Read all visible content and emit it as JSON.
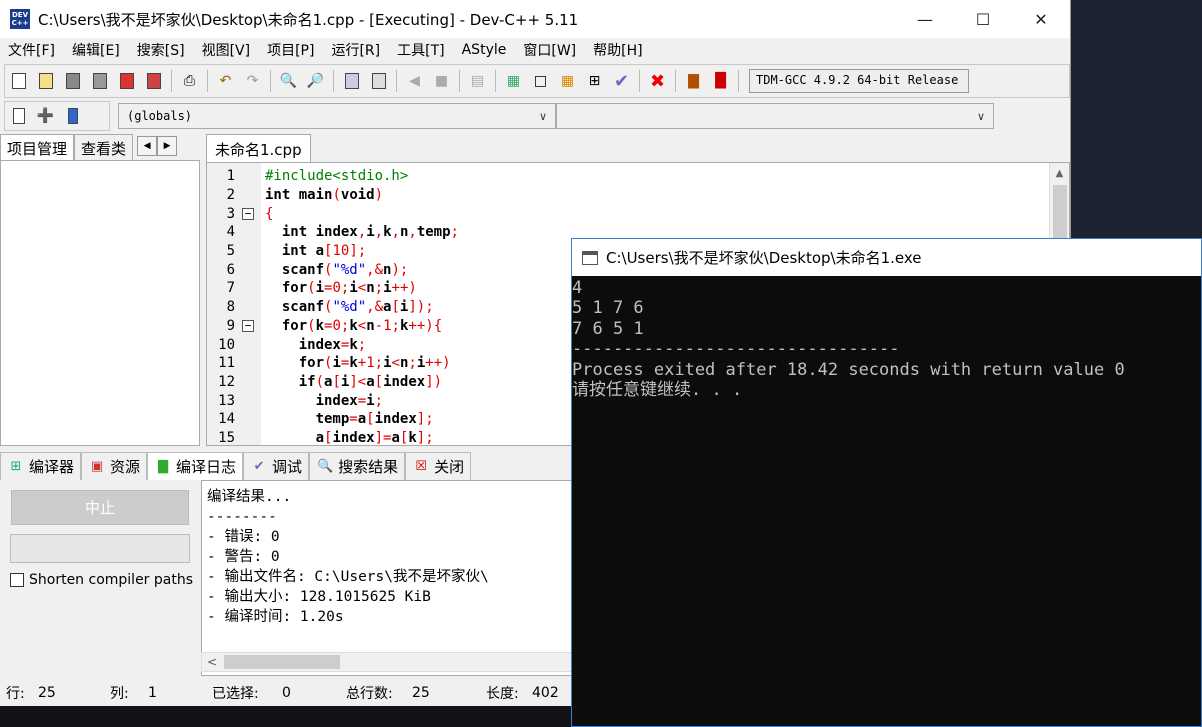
{
  "ide": {
    "title": "C:\\Users\\我不是坏家伙\\Desktop\\未命名1.cpp - [Executing] - Dev-C++ 5.11",
    "app_icon_text": "DEV C++",
    "menu": [
      "文件[F]",
      "编辑[E]",
      "搜索[S]",
      "视图[V]",
      "项目[P]",
      "运行[R]",
      "工具[T]",
      "AStyle",
      "窗口[W]",
      "帮助[H]"
    ],
    "compiler_select": "TDM-GCC 4.9.2 64-bit Release",
    "scope_combo": "(globals)",
    "left_tabs": [
      "项目管理",
      "查看类"
    ],
    "editor_tab": "未命名1.cpp",
    "bottom_tabs": [
      "编译器",
      "资源",
      "编译日志",
      "调试",
      "搜索结果",
      "关闭"
    ],
    "abort_button": "中止",
    "shorten_paths_label": "Shorten compiler paths",
    "log_lines": [
      "编译结果...",
      "--------",
      "- 错误: 0",
      "- 警告: 0",
      "- 输出文件名: C:\\Users\\我不是坏家伙\\",
      "- 输出大小: 128.1015625 KiB",
      "- 编译时间: 1.20s"
    ],
    "status": {
      "row_label": "行:",
      "row_value": "25",
      "col_label": "列:",
      "col_value": "1",
      "sel_label": "已选择:",
      "sel_value": "0",
      "lines_label": "总行数:",
      "lines_value": "25",
      "len_label": "长度:",
      "len_value": "402"
    }
  },
  "code_lines": [
    {
      "n": "1",
      "fold": "",
      "html": "<span class=\"pp\">#include&lt;stdio.h&gt;</span>"
    },
    {
      "n": "2",
      "fold": "",
      "html": "<span class=\"kw\">int</span> <b>main</b><span class=\"sym\">(</span><span class=\"kw\">void</span><span class=\"sym\">)</span>"
    },
    {
      "n": "3",
      "fold": "−",
      "html": "<span class=\"sym\">{</span>"
    },
    {
      "n": "4",
      "fold": "",
      "html": "  <span class=\"kw\">int</span> <b>index</b><span class=\"sym\">,</span><b>i</b><span class=\"sym\">,</span><b>k</b><span class=\"sym\">,</span><b>n</b><span class=\"sym\">,</span><b>temp</b><span class=\"sym\">;</span>"
    },
    {
      "n": "5",
      "fold": "",
      "html": "  <span class=\"kw\">int</span> <b>a</b><span class=\"sym\">[</span><span class=\"num\">10</span><span class=\"sym\">];</span>"
    },
    {
      "n": "6",
      "fold": "",
      "html": "  <b>scanf</b><span class=\"sym\">(</span><span class=\"str\">\"%d\"</span><span class=\"sym\">,&amp;</span><b>n</b><span class=\"sym\">);</span>"
    },
    {
      "n": "7",
      "fold": "",
      "html": "  <span class=\"kw\">for</span><span class=\"sym\">(</span><b>i</b><span class=\"sym\">=</span><span class=\"num\">0</span><span class=\"sym\">;</span><b>i</b><span class=\"sym\">&lt;</span><b>n</b><span class=\"sym\">;</span><b>i</b><span class=\"sym\">++)</span>"
    },
    {
      "n": "8",
      "fold": "",
      "html": "  <b>scanf</b><span class=\"sym\">(</span><span class=\"str\">\"%d\"</span><span class=\"sym\">,&amp;</span><b>a</b><span class=\"sym\">[</span><b>i</b><span class=\"sym\">]);</span>"
    },
    {
      "n": "9",
      "fold": "−",
      "html": "  <span class=\"kw\">for</span><span class=\"sym\">(</span><b>k</b><span class=\"sym\">=</span><span class=\"num\">0</span><span class=\"sym\">;</span><b>k</b><span class=\"sym\">&lt;</span><b>n</b><span class=\"sym\">-</span><span class=\"num\">1</span><span class=\"sym\">;</span><b>k</b><span class=\"sym\">++){</span>"
    },
    {
      "n": "10",
      "fold": "",
      "html": "    <b>index</b><span class=\"sym\">=</span><b>k</b><span class=\"sym\">;</span>"
    },
    {
      "n": "11",
      "fold": "",
      "html": "    <span class=\"kw\">for</span><span class=\"sym\">(</span><b>i</b><span class=\"sym\">=</span><b>k</b><span class=\"sym\">+</span><span class=\"num\">1</span><span class=\"sym\">;</span><b>i</b><span class=\"sym\">&lt;</span><b>n</b><span class=\"sym\">;</span><b>i</b><span class=\"sym\">++)</span>"
    },
    {
      "n": "12",
      "fold": "",
      "html": "    <span class=\"kw\">if</span><span class=\"sym\">(</span><b>a</b><span class=\"sym\">[</span><b>i</b><span class=\"sym\">]&lt;</span><b>a</b><span class=\"sym\">[</span><b>index</b><span class=\"sym\">])</span>"
    },
    {
      "n": "13",
      "fold": "",
      "html": "      <b>index</b><span class=\"sym\">=</span><b>i</b><span class=\"sym\">;</span>"
    },
    {
      "n": "14",
      "fold": "",
      "html": "      <b>temp</b><span class=\"sym\">=</span><b>a</b><span class=\"sym\">[</span><b>index</b><span class=\"sym\">];</span>"
    },
    {
      "n": "15",
      "fold": "",
      "html": "      <b>a</b><span class=\"sym\">[</span><b>index</b><span class=\"sym\">]=</span><b>a</b><span class=\"sym\">[</span><b>k</b><span class=\"sym\">];</span>"
    }
  ],
  "console": {
    "title": "C:\\Users\\我不是坏家伙\\Desktop\\未命名1.exe",
    "lines": [
      "4",
      "5 1 7 6",
      "7 6 5 1",
      "--------------------------------",
      "Process exited after 18.42 seconds with return value 0",
      "请按任意键继续. . ."
    ]
  }
}
